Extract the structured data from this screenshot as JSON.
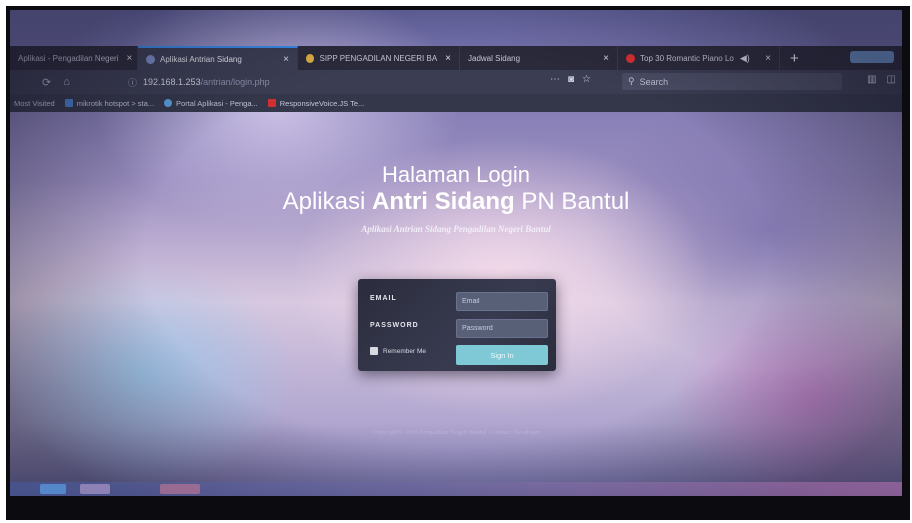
{
  "browser": {
    "tabs": [
      {
        "label": "Aplikasi - Pengadilan Negeri",
        "fav_color": "#888ab0",
        "active": false
      },
      {
        "label": "Aplikasi Antrian Sidang",
        "fav_color": "#7c90c8",
        "active": true
      },
      {
        "label": "SIPP PENGADILAN NEGERI BA",
        "fav_color": "#e0b040",
        "active": false
      },
      {
        "label": "Jadwal Sidang",
        "fav_color": "#9aa0c0",
        "active": false
      },
      {
        "label": "Top 30 Romantic Piano Lo",
        "fav_color": "#e03030",
        "active": false
      }
    ],
    "close_symbol": "×",
    "new_tab_symbol": "+",
    "speaker_symbol": "◀)",
    "url_host": "192.168.1.253",
    "url_path": "/antrian/login.php",
    "search_placeholder": "Search",
    "bookmarks": [
      {
        "label": "Most Visited",
        "icon_color": ""
      },
      {
        "label": "mikrotik hotspot > sta...",
        "icon_color": "#4a80d0"
      },
      {
        "label": "Portal Aplikasi - Penga...",
        "icon_color": "#5aa0e0"
      },
      {
        "label": "ResponsiveVoice.JS Te...",
        "icon_color": "#d03030"
      }
    ]
  },
  "page": {
    "title_line1": "Halaman Login",
    "title_line2_prefix": "Aplikasi ",
    "title_line2_bold": "Antri Sidang",
    "title_line2_suffix": " PN Bantul",
    "subtitle": "Aplikasi Antrian Sidang Pengadilan Negeri Bantul",
    "login": {
      "email_label": "EMAIL",
      "email_placeholder": "Email",
      "password_label": "PASSWORD",
      "password_placeholder": "Password",
      "remember_label": "Remember Me",
      "signin_label": "Sign In"
    },
    "copyright": "Copyright© 2019 Pengadilan Negeri Bantul | Contact Developer"
  },
  "colors": {
    "accent": "#3a8ef0",
    "signin_button": "#7fc9d6",
    "card_bg": "#2b2d3d"
  }
}
